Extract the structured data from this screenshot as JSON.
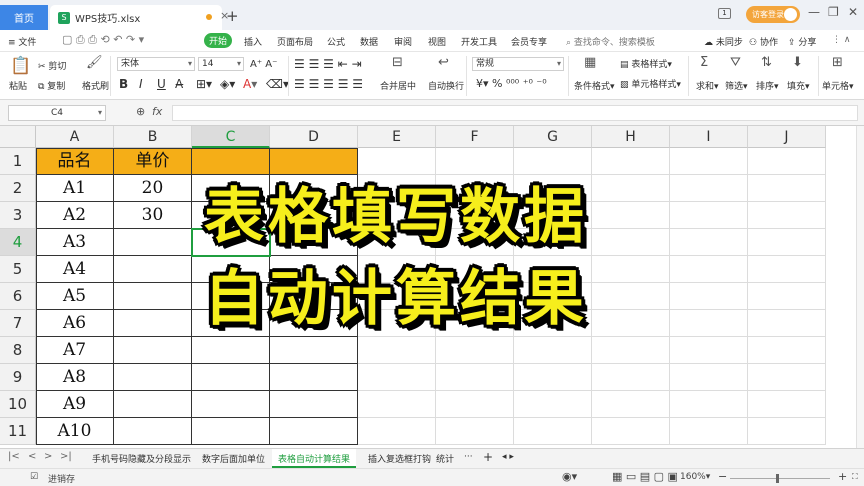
{
  "titlebar": {
    "home_tab": "首页",
    "doc_tab": "WPS技巧.xlsx",
    "doc_icon": "S",
    "close_glyph": "×",
    "new_tab_glyph": "+",
    "badge": "1",
    "login_label": "访客登录",
    "window_controls": [
      "—",
      "❐",
      "✕"
    ]
  },
  "menubar": {
    "file": "≡ 文件",
    "items": [
      "开始",
      "插入",
      "页面布局",
      "公式",
      "数据",
      "审阅",
      "视图",
      "开发工具",
      "会员专享"
    ],
    "search_placeholder": "查找命令、搜索模板",
    "right": [
      "未同步",
      "协作",
      "分享"
    ]
  },
  "ribbon": {
    "paste": "粘贴",
    "cut": "剪切",
    "copy": "复制",
    "format_painter": "格式刷",
    "font_name": "宋体",
    "font_size": "14",
    "merge": "合并居中",
    "wrap": "自动换行",
    "number_format": "常规",
    "cond_format": "条件格式",
    "table_style": "表格样式",
    "cell_style": "单元格样式",
    "sum": "求和",
    "filter": "筛选",
    "sort": "排序",
    "fill": "填充",
    "cell": "单元格",
    "bold": "B",
    "italic": "I",
    "underline": "U",
    "currency": "¥",
    "percent": "%"
  },
  "formula_bar": {
    "name_box": "C4",
    "fx": "fx",
    "zoom_icon": "⊕"
  },
  "sheet": {
    "columns": [
      "A",
      "B",
      "C",
      "D",
      "E",
      "F",
      "G",
      "H",
      "I",
      "J"
    ],
    "rows": [
      "1",
      "2",
      "3",
      "4",
      "5",
      "6",
      "7",
      "8",
      "9",
      "10",
      "11"
    ],
    "selected_column": "C",
    "selected_row": "4",
    "header": [
      "品名",
      "单价",
      "",
      ""
    ],
    "data": [
      [
        "A1",
        "20",
        "",
        ""
      ],
      [
        "A2",
        "30",
        "",
        ""
      ],
      [
        "A3",
        "",
        "",
        ""
      ],
      [
        "A4",
        "",
        "",
        ""
      ],
      [
        "A5",
        "",
        "",
        ""
      ],
      [
        "A6",
        "",
        "",
        ""
      ],
      [
        "A7",
        "",
        "",
        ""
      ],
      [
        "A8",
        "",
        "",
        ""
      ],
      [
        "A9",
        "",
        "",
        ""
      ],
      [
        "A10",
        "",
        "",
        ""
      ]
    ],
    "header_color": "#f5ae17"
  },
  "overlay": {
    "line1": "表格填写数据",
    "line2": "自动计算结果",
    "color": "#f6ee1c"
  },
  "sheet_tabs": {
    "nav": [
      "|<",
      "<",
      ">",
      ">|"
    ],
    "tabs": [
      "手机号码隐藏及分段显示",
      "数字后面加单位",
      "表格自动计算结果",
      "插入复选框打钩",
      "统计"
    ],
    "active_index": 2,
    "more": "···",
    "add": "+"
  },
  "status": {
    "left": "进销存",
    "zoom": "160%"
  }
}
